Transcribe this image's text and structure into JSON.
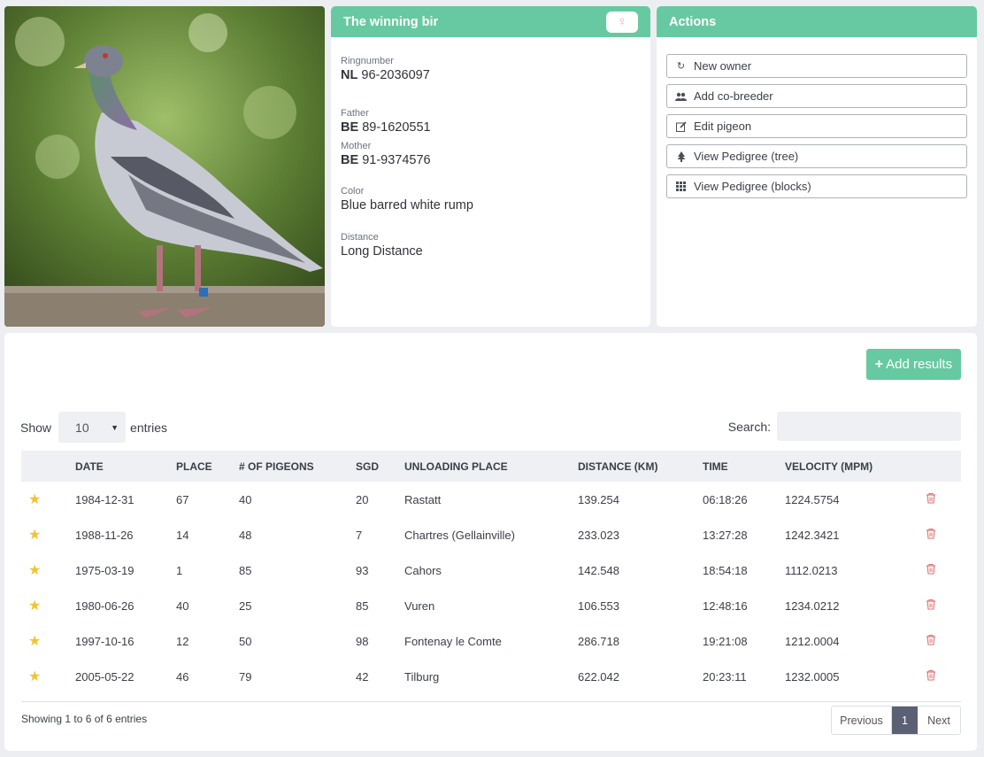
{
  "info": {
    "title": "The winning bir",
    "gender_icon": "female-icon",
    "ring_label": "Ringnumber",
    "ring_country": "NL",
    "ring_number": "96-2036097",
    "father_label": "Father",
    "father_country": "BE",
    "father_number": "89-1620551",
    "mother_label": "Mother",
    "mother_country": "BE",
    "mother_number": "91-9374576",
    "color_label": "Color",
    "color_value": "Blue barred white rump",
    "distance_label": "Distance",
    "distance_value": "Long Distance"
  },
  "actions": {
    "title": "Actions",
    "buttons": [
      {
        "label": "New owner",
        "icon": "refresh-icon"
      },
      {
        "label": "Add co-breeder",
        "icon": "users-icon"
      },
      {
        "label": "Edit pigeon",
        "icon": "edit-icon"
      },
      {
        "label": "View Pedigree (tree)",
        "icon": "tree-icon"
      },
      {
        "label": "View Pedigree (blocks)",
        "icon": "grid-icon"
      }
    ]
  },
  "results": {
    "add_label": "Add results",
    "show_label": "Show",
    "page_size": "10",
    "entries_label": "entries",
    "search_label": "Search:",
    "columns": [
      "DATE",
      "PLACE",
      "# OF PIGEONS",
      "SGD",
      "UNLOADING PLACE",
      "DISTANCE (KM)",
      "TIME",
      "VELOCITY (MPM)"
    ],
    "rows": [
      {
        "date": "1984-12-31",
        "place": "67",
        "pigeons": "40",
        "sgd": "20",
        "unloading": "Rastatt",
        "distance": "139.254",
        "time": "06:18:26",
        "velocity": "1224.5754"
      },
      {
        "date": "1988-11-26",
        "place": "14",
        "pigeons": "48",
        "sgd": "7",
        "unloading": "Chartres (Gellainville)",
        "distance": "233.023",
        "time": "13:27:28",
        "velocity": "1242.3421"
      },
      {
        "date": "1975-03-19",
        "place": "1",
        "pigeons": "85",
        "sgd": "93",
        "unloading": "Cahors",
        "distance": "142.548",
        "time": "18:54:18",
        "velocity": "1112.0213"
      },
      {
        "date": "1980-06-26",
        "place": "40",
        "pigeons": "25",
        "sgd": "85",
        "unloading": "Vuren",
        "distance": "106.553",
        "time": "12:48:16",
        "velocity": "1234.0212"
      },
      {
        "date": "1997-10-16",
        "place": "12",
        "pigeons": "50",
        "sgd": "98",
        "unloading": "Fontenay le Comte",
        "distance": "286.718",
        "time": "19:21:08",
        "velocity": "1212.0004"
      },
      {
        "date": "2005-05-22",
        "place": "46",
        "pigeons": "79",
        "sgd": "42",
        "unloading": "Tilburg",
        "distance": "622.042",
        "time": "20:23:11",
        "velocity": "1232.0005"
      }
    ],
    "showing_text": "Showing 1 to 6 of 6 entries",
    "prev_label": "Previous",
    "current_page": "1",
    "next_label": "Next"
  },
  "colors": {
    "accent": "#67c9a1",
    "star": "#efc534",
    "delete": "#e56e6e",
    "active_page": "#5b6075"
  }
}
